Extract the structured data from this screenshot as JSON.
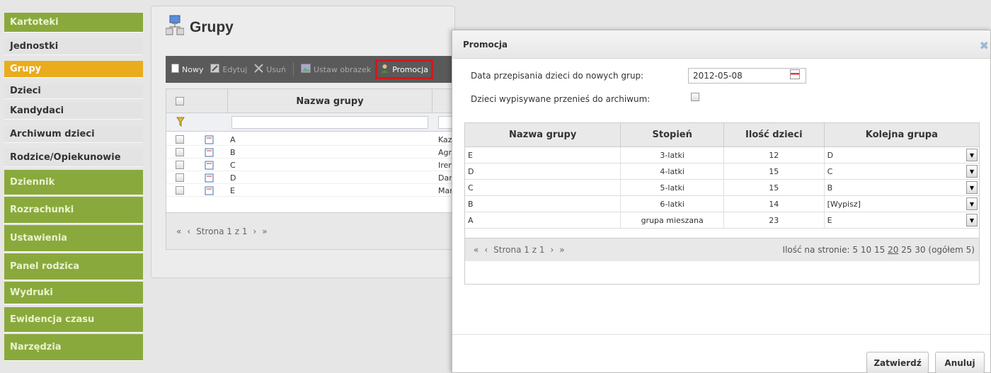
{
  "sidebar": {
    "items": [
      {
        "label": "Kartoteki"
      },
      {
        "label": "Jednostki"
      },
      {
        "label": "Grupy"
      },
      {
        "label": "Dzieci"
      },
      {
        "label": "Kandydaci"
      },
      {
        "label": "Archiwum dzieci"
      },
      {
        "label": "Rodzice/Opiekunowie"
      },
      {
        "label": "Dziennik"
      },
      {
        "label": "Rozrachunki"
      },
      {
        "label": "Ustawienia"
      },
      {
        "label": "Panel rodzica"
      },
      {
        "label": "Wydruki"
      },
      {
        "label": "Ewidencja czasu"
      },
      {
        "label": "Narzędzia"
      }
    ]
  },
  "page": {
    "title": "Grupy"
  },
  "toolbar": {
    "new_label": "Nowy",
    "edit_label": "Edytuj",
    "delete_label": "Usuń",
    "set_image_label": "Ustaw obrazek",
    "promo_label": "Promocja"
  },
  "grid": {
    "col_name": "Nazwa grupy",
    "rows": [
      {
        "name": "A",
        "teacher": "Kazi"
      },
      {
        "name": "B",
        "teacher": "Agn"
      },
      {
        "name": "C",
        "teacher": "Iren"
      },
      {
        "name": "D",
        "teacher": "Dan"
      },
      {
        "name": "E",
        "teacher": "Mar"
      }
    ],
    "pager": {
      "page_text": "Strona 1 z 1"
    }
  },
  "dialog": {
    "title": "Promocja",
    "close_glyph": "✖",
    "date_label": "Data przepisania dzieci do nowych grup:",
    "date_value": "2012-05-08",
    "archive_label": "Dzieci wypisywane przenieś do archiwum:",
    "table": {
      "headers": [
        "Nazwa grupy",
        "Stopień",
        "Ilość dzieci",
        "Kolejna grupa"
      ],
      "rows": [
        {
          "name": "E",
          "level": "3-latki",
          "count": "12",
          "next": "D"
        },
        {
          "name": "D",
          "level": "4-latki",
          "count": "15",
          "next": "C"
        },
        {
          "name": "C",
          "level": "5-latki",
          "count": "15",
          "next": "B"
        },
        {
          "name": "B",
          "level": "6-latki",
          "count": "14",
          "next": "[Wypisz]"
        },
        {
          "name": "A",
          "level": "grupa mieszana",
          "count": "23",
          "next": "E"
        }
      ],
      "pager": {
        "page_text": "Strona 1 z 1",
        "per_page_label": "Ilość na stronie:",
        "per_page_options": [
          "5",
          "10",
          "15",
          "20",
          "25",
          "30"
        ],
        "selected": "20",
        "total_text": "(ogółem 5)"
      }
    },
    "confirm_label": "Zatwierdź",
    "cancel_label": "Anuluj"
  },
  "colors": {
    "sidebar_green": "#8aa93c",
    "sidebar_active": "#e8ac1c",
    "toolbar_bg": "#5a5a5a",
    "highlight_red": "#d0191e"
  }
}
